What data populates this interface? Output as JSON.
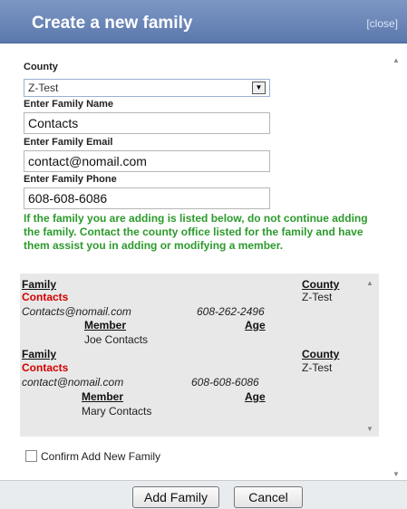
{
  "dialog": {
    "title": "Create a new family",
    "close_label": "[close]"
  },
  "form": {
    "county_label": "County",
    "county_value": "Z-Test",
    "name_label": "Enter Family Name",
    "name_value": "Contacts",
    "email_label": "Enter Family Email",
    "email_value": "contact@nomail.com",
    "phone_label": "Enter Family Phone",
    "phone_value": "608-608-6086"
  },
  "warning": "If the family you are adding is listed below, do not continue adding the family. Contact the county office listed for the family and have them assist you in adding or modifying a member.",
  "results": [
    {
      "family_header": "Family",
      "county_header": "County",
      "family_name": "Contacts",
      "county": "Z-Test",
      "email": "Contacts@nomail.com",
      "phone": "608-262-2496",
      "member_header": "Member",
      "age_header": "Age",
      "member": "Joe Contacts"
    },
    {
      "family_header": "Family",
      "county_header": "County",
      "family_name": "Contacts",
      "county": "Z-Test",
      "email": "contact@nomail.com",
      "phone": "608-608-6086",
      "member_header": "Member",
      "age_header": "Age",
      "member": "Mary Contacts"
    }
  ],
  "confirm_label": "Confirm Add New Family",
  "buttons": {
    "add": "Add Family",
    "cancel": "Cancel"
  }
}
